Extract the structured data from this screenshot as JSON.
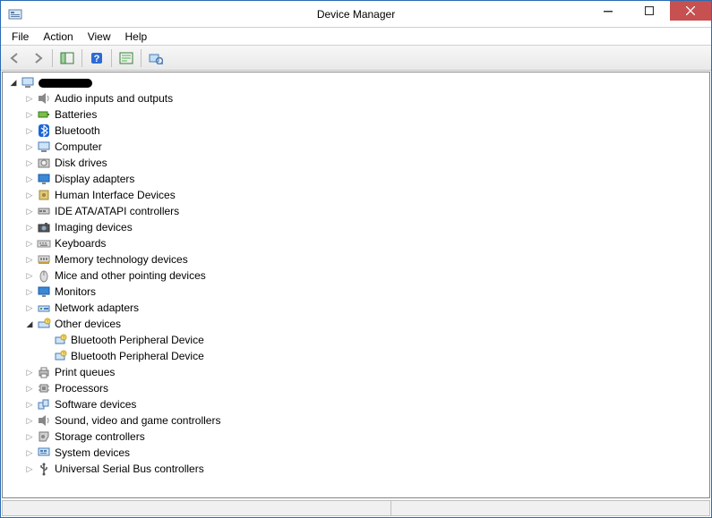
{
  "window": {
    "title": "Device Manager"
  },
  "menu": {
    "file": "File",
    "action": "Action",
    "view": "View",
    "help": "Help"
  },
  "toolbar": {
    "back": "Back",
    "forward": "Forward",
    "show_hide": "Show/Hide Console Tree",
    "help": "Help",
    "properties": "Properties",
    "scan": "Scan for hardware changes"
  },
  "tree": {
    "root_redacted": true,
    "categories": [
      {
        "label": "Audio inputs and outputs",
        "icon": "audio"
      },
      {
        "label": "Batteries",
        "icon": "battery"
      },
      {
        "label": "Bluetooth",
        "icon": "bluetooth"
      },
      {
        "label": "Computer",
        "icon": "computer"
      },
      {
        "label": "Disk drives",
        "icon": "disk"
      },
      {
        "label": "Display adapters",
        "icon": "display"
      },
      {
        "label": "Human Interface Devices",
        "icon": "hid"
      },
      {
        "label": "IDE ATA/ATAPI controllers",
        "icon": "ide"
      },
      {
        "label": "Imaging devices",
        "icon": "imaging"
      },
      {
        "label": "Keyboards",
        "icon": "keyboard"
      },
      {
        "label": "Memory technology devices",
        "icon": "memory"
      },
      {
        "label": "Mice and other pointing devices",
        "icon": "mouse"
      },
      {
        "label": "Monitors",
        "icon": "monitor"
      },
      {
        "label": "Network adapters",
        "icon": "network"
      },
      {
        "label": "Other devices",
        "icon": "other",
        "expanded": true,
        "children": [
          {
            "label": "Bluetooth Peripheral Device",
            "icon": "unknown"
          },
          {
            "label": "Bluetooth Peripheral Device",
            "icon": "unknown"
          }
        ]
      },
      {
        "label": "Print queues",
        "icon": "printer"
      },
      {
        "label": "Processors",
        "icon": "cpu"
      },
      {
        "label": "Software devices",
        "icon": "software"
      },
      {
        "label": "Sound, video and game controllers",
        "icon": "sound"
      },
      {
        "label": "Storage controllers",
        "icon": "storage"
      },
      {
        "label": "System devices",
        "icon": "system"
      },
      {
        "label": "Universal Serial Bus controllers",
        "icon": "usb"
      }
    ]
  }
}
